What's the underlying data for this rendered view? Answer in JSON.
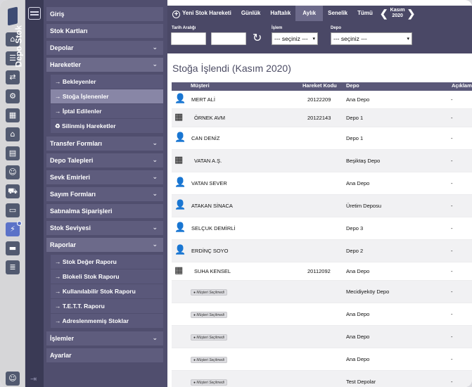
{
  "module": {
    "title": "Depo Stok"
  },
  "menu": {
    "items": [
      {
        "label": "Giriş",
        "chevron": false
      },
      {
        "label": "Stok Kartları",
        "chevron": false
      },
      {
        "label": "Depolar",
        "chevron": true
      },
      {
        "label": "Hareketler",
        "chevron": true,
        "open": true,
        "children": [
          "→ Bekleyenler",
          "→ Stoğa İşlenenler",
          "→ İptal Edilenler",
          "♻ Silinmiş Hareketler"
        ]
      },
      {
        "label": "Transfer Formları",
        "chevron": true
      },
      {
        "label": "Depo Talepleri",
        "chevron": true
      },
      {
        "label": "Sevk Emirleri",
        "chevron": true
      },
      {
        "label": "Sayım Formları",
        "chevron": true
      },
      {
        "label": "Satınalma Siparişleri",
        "chevron": false
      },
      {
        "label": "Stok Seviyesi",
        "chevron": true
      },
      {
        "label": "Raporlar",
        "chevron": true,
        "open": true,
        "children": [
          "→ Stok Değer Raporu",
          "→ Blokeli Stok Raporu",
          "→ Kullanılabilir Stok Raporu",
          "→ T.E.T.T. Raporu",
          "→ Adreslenmemiş Stoklar"
        ]
      },
      {
        "label": "İşlemler",
        "chevron": true
      },
      {
        "label": "Ayarlar",
        "chevron": false
      }
    ]
  },
  "topbar": {
    "new_label": "Yeni Stok Hareketi",
    "tabs": [
      "Günlük",
      "Haftalık",
      "Aylık",
      "Senelik",
      "Tümü"
    ],
    "active_tab": "Aylık",
    "month": "Kasım",
    "year": "2020"
  },
  "filters": {
    "date_label": "Tarih Aralığı",
    "islem_label": "İşlem",
    "islem_value": "--- seçiniz ---",
    "depo_label": "Depo",
    "depo_value": "--- seçiniz ---"
  },
  "page": {
    "title": "Stoğa İşlendi",
    "period": "(Kasım 2020)"
  },
  "table": {
    "columns": [
      "Müşteri",
      "Hareket Kodu",
      "Depo",
      "Açıklama"
    ],
    "badge_text": "● Müşteri Seçilmedi",
    "rows": [
      {
        "kind": "person",
        "customer": "MERT ALİ",
        "code": "20122209",
        "depo": "Ana Depo",
        "note": "-"
      },
      {
        "kind": "company",
        "customer": "ÖRNEK AVM",
        "code": "20122143",
        "depo": "Depo 1",
        "note": "-"
      },
      {
        "kind": "person",
        "customer": "CAN DENİZ",
        "code": "",
        "depo": "Depo 1",
        "note": "-"
      },
      {
        "kind": "company",
        "customer": "VATAN A.Ş.",
        "code": "",
        "depo": "Beşiktaş Depo",
        "note": "-"
      },
      {
        "kind": "person",
        "customer": "VATAN SEVER",
        "code": "",
        "depo": "Ana Depo",
        "note": "-"
      },
      {
        "kind": "person",
        "customer": "ATAKAN SİNACA",
        "code": "",
        "depo": "Üretim Deposu",
        "note": "-"
      },
      {
        "kind": "person",
        "customer": "SELÇUK DEMİRLİ",
        "code": "",
        "depo": "Depo 3",
        "note": "-"
      },
      {
        "kind": "person",
        "customer": "ERDİNÇ SOYO",
        "code": "",
        "depo": "Depo 2",
        "note": "-"
      },
      {
        "kind": "company",
        "customer": "SUHA KENSEL",
        "code": "20112092",
        "depo": "Ana Depo",
        "note": "-"
      },
      {
        "kind": "none",
        "customer": "",
        "code": "",
        "depo": "Mecidiyeköy Depo",
        "note": "-"
      },
      {
        "kind": "none",
        "customer": "",
        "code": "",
        "depo": "Ana Depo",
        "note": "-"
      },
      {
        "kind": "none",
        "customer": "",
        "code": "",
        "depo": "Ana Depo",
        "note": "-"
      },
      {
        "kind": "none",
        "customer": "",
        "code": "",
        "depo": "Ana Depo",
        "note": "-"
      },
      {
        "kind": "none",
        "customer": "",
        "code": "",
        "depo": "Test Depolar",
        "note": "-"
      }
    ]
  },
  "rail": {
    "icons": [
      "home-icon",
      "list-icon",
      "user-transfer-icon",
      "gear-icon",
      "calculator-icon",
      "factory-icon",
      "document-icon",
      "users-icon",
      "cart-icon",
      "money-icon",
      "plug-icon",
      "wallet-icon",
      "ledger-icon"
    ],
    "active": "plug-icon"
  },
  "colors": {
    "menu_bg": "#504e6e",
    "topbar_bg": "#4a4866",
    "active": "#6c6a8a",
    "rail_active": "#5b72c8"
  }
}
